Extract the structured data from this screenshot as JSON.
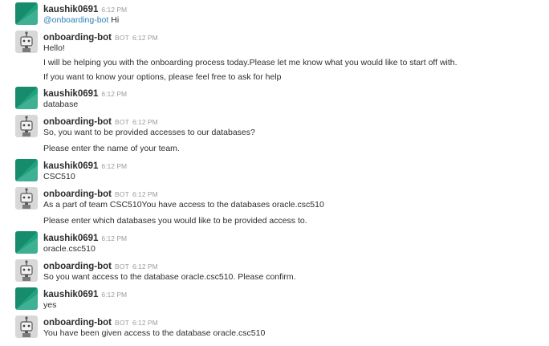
{
  "colors": {
    "user_avatar": "#1fa37f",
    "user_avatar_dark": "#117a5e",
    "bot_avatar_bg": "#d8d8d8",
    "mention": "#2a80b9",
    "meta": "#9b9b9b"
  },
  "messages": [
    {
      "author": "kaushik0691",
      "time": "6:12 PM",
      "bot": false,
      "mention": "@onboarding-bot",
      "lines": [
        " Hi"
      ]
    },
    {
      "author": "onboarding-bot",
      "badge": "BOT",
      "time": "6:12 PM",
      "bot": true,
      "lines": [
        "Hello!",
        "I will be helping you with the onboarding process today.Please let me know what you would like to start off with.",
        "If you want to know your options, please feel free to ask for help"
      ]
    },
    {
      "author": "kaushik0691",
      "time": "6:12 PM",
      "bot": false,
      "lines": [
        "database"
      ]
    },
    {
      "author": "onboarding-bot",
      "badge": "BOT",
      "time": "6:12 PM",
      "bot": true,
      "lines": [
        "So, you want to be provided accesses to our databases?",
        "Please enter the name of your team."
      ]
    },
    {
      "author": "kaushik0691",
      "time": "6:12 PM",
      "bot": false,
      "lines": [
        "CSC510"
      ]
    },
    {
      "author": "onboarding-bot",
      "badge": "BOT",
      "time": "6:12 PM",
      "bot": true,
      "lines": [
        "As a part of team CSC510You have access to the databases oracle.csc510",
        "Please enter which databases you would like to be provided access to."
      ]
    },
    {
      "author": "kaushik0691",
      "time": "6:12 PM",
      "bot": false,
      "lines": [
        "oracle.csc510"
      ]
    },
    {
      "author": "onboarding-bot",
      "badge": "BOT",
      "time": "6:12 PM",
      "bot": true,
      "lines": [
        "So you want access to the database oracle.csc510. Please confirm."
      ]
    },
    {
      "author": "kaushik0691",
      "time": "6:12 PM",
      "bot": false,
      "lines": [
        "yes"
      ]
    },
    {
      "author": "onboarding-bot",
      "badge": "BOT",
      "time": "6:12 PM",
      "bot": true,
      "lines": [
        "You have been given access to the database oracle.csc510"
      ]
    }
  ]
}
